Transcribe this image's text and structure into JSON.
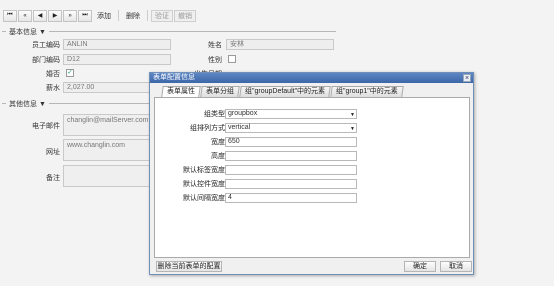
{
  "toolbar": {
    "first": "⏮",
    "prev_page": "«",
    "prev": "◀",
    "next": "▶",
    "next_page": "»",
    "last": "⏭",
    "add": "添加",
    "delete": "删除",
    "edit": "验证",
    "cancel": "撤销"
  },
  "basic": {
    "title": "基本信息 ▼",
    "emp_no_label": "员工编码",
    "emp_no_value": "ANLIN",
    "name_label": "姓名",
    "name_value": "安林",
    "dept_label": "部门编码",
    "dept_value": "D12",
    "gender_label": "性别",
    "married_label": "婚否",
    "hire_label": "出生日期",
    "salary_label": "薪水",
    "salary_value": "2,027.00"
  },
  "other": {
    "title": "其他信息 ▼",
    "email_label": "电子邮件",
    "email_value": "changlin@mailServer.com",
    "url_label": "网址",
    "url_value": "www.changlin.com",
    "remark_label": "备注"
  },
  "dialog": {
    "title": "表单配置信息",
    "close": "×",
    "tabs": [
      "表单属性",
      "表单分组",
      "组\"groupDefault\"中的元素",
      "组\"group1\"中的元素"
    ],
    "group_type_label": "组类型",
    "group_type_value": "groupbox",
    "layout_label": "组排列方式",
    "layout_value": "vertical",
    "width_label": "宽度",
    "width_value": "650",
    "height_label": "高度",
    "height_value": "",
    "label_width_label": "默认标签宽度",
    "label_width_value": "",
    "control_width_label": "默认控件宽度",
    "control_width_value": "",
    "gap_width_label": "默认间隔宽度",
    "gap_width_value": "4",
    "delete_config": "删除当前表单的配置",
    "ok": "确定",
    "cancel": "取消"
  }
}
